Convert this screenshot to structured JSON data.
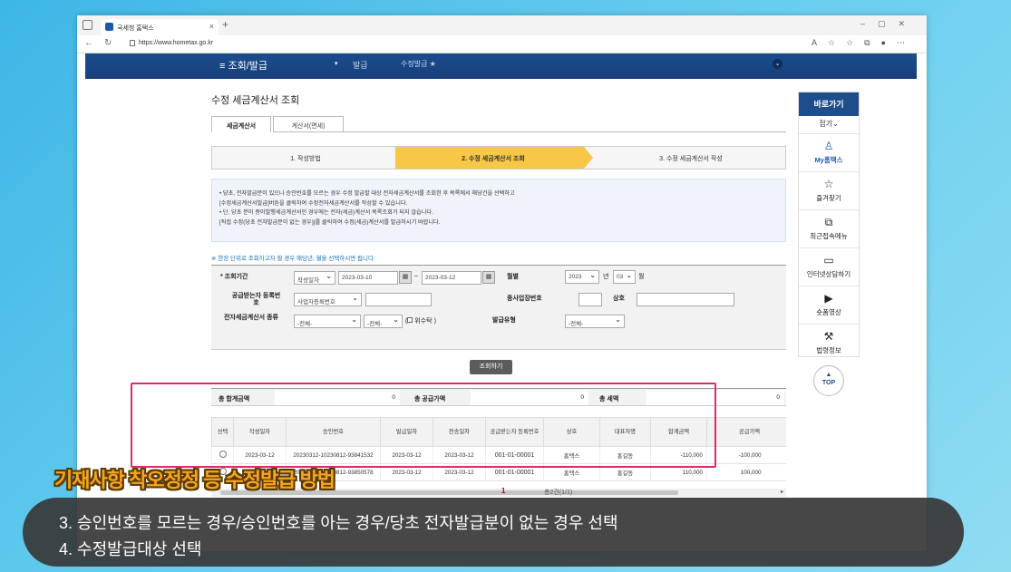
{
  "browser": {
    "tab_title": "국세청 홈택스",
    "url": "https://www.hometax.go.kr",
    "new_tab": "+",
    "close_tab": "×"
  },
  "gnb": {
    "menu": "≡ 조회/발급",
    "crumb1": "발급",
    "crumb2": "수정발급 ★"
  },
  "page": {
    "title": "수정 세금계산서 조회",
    "tabs": [
      "세금계산서",
      "계산서(면세)"
    ],
    "steps": [
      "1. 작성방법",
      "2. 수정 세금계산서 조회",
      "3. 수정 세금계산서 작성"
    ],
    "info_lines": [
      "• 당초, 전자발급분이 있으나 승인번호를 모르는 경우 수정 발급할 대상 전자세금계산서를 조회한 후 목록에서 해당건을 선택하고",
      "   [수정세금계산서발급]버튼을 클릭하여 수정전자세금계산서를 작성할 수 있습니다.",
      "• 단, 당초 분이 종이발행세금계산서인 경우에는 전자(세금)계산서 목록조회가 되지 않습니다.",
      "   [직접 수정(당초 전자발급분이 없는 경우)]를 클릭하여 수정(세금)계산서를 발급하시기 바랍니다."
    ],
    "note": "※ 한장 단위로 조회하고자 할 경우 해당년, 월을 선택하시면 됩니다."
  },
  "form": {
    "period_label": "* 조회기간",
    "date_type": "작성일자",
    "date_from": "2023-03-10",
    "date_to": "2023-03-12",
    "tilde": "~",
    "month_label": "월별",
    "year": "2023",
    "year_unit": "년",
    "month": "03",
    "month_unit": "월",
    "supplier_label": "공급받는자 등록번호",
    "reg_type": "사업자등록번호",
    "workplace_label": "종사업장번호",
    "company_label": "상호",
    "einvoice_label": "전자세금계산서 종류",
    "kind1": "-전체-",
    "kind2": "-전체-",
    "consign_label": "위수탁",
    "issue_type_label": "발급유형",
    "issue_type": "-전체-",
    "search_button": "조회하기"
  },
  "totals": {
    "total_label": "총 합계금액",
    "total_value": "0",
    "supply_label": "총 공급가액",
    "supply_value": "0",
    "tax_label": "총 세액",
    "tax_value": "0"
  },
  "table": {
    "headers": [
      "선택",
      "작성일자",
      "승인번호",
      "발급일자",
      "전송일자",
      "공급받는자 등록번호",
      "상호",
      "대표자명",
      "합계금액",
      "공급가액"
    ],
    "rows": [
      [
        "",
        "2023-03-12",
        "20230312-10230812-93841532",
        "2023-03-12",
        "2023-03-12",
        "001-01-00001",
        "홈택스",
        "홍길동",
        "-110,000",
        "-100,000"
      ],
      [
        "",
        "2023-03-12",
        "20230312-10230812-93850578",
        "2023-03-12",
        "2023-03-12",
        "001-01-00001",
        "홈택스",
        "홍길동",
        "110,000",
        "100,000"
      ]
    ],
    "page_current": "1",
    "page_summary": "총2건(1/1)"
  },
  "sidebar": {
    "title": "바로가기",
    "fold": "접기⌄",
    "items": [
      {
        "icon": "person-icon",
        "label": "My홈택스"
      },
      {
        "icon": "star-icon",
        "label": "즐겨찾기"
      },
      {
        "icon": "recent-icon",
        "label": "최근접속메뉴"
      },
      {
        "icon": "monitor-icon",
        "label": "인터넷상담하기"
      },
      {
        "icon": "play-icon",
        "label": "숏폼영상"
      },
      {
        "icon": "gavel-icon",
        "label": "법령정보"
      }
    ],
    "top": "TOP"
  },
  "caption": {
    "title": "기재사항 착오정정 등 수정발급 방법",
    "line1": "3. 승인번호를 모르는 경우/승인번호를 아는 경우/당초 전자발급분이 없는 경우 선택",
    "line2": "4. 수정발급대상 선택"
  },
  "colors": {
    "highlight": "#e5266e",
    "step_active": "#f7c745",
    "gnb": "#1a4c8e"
  }
}
